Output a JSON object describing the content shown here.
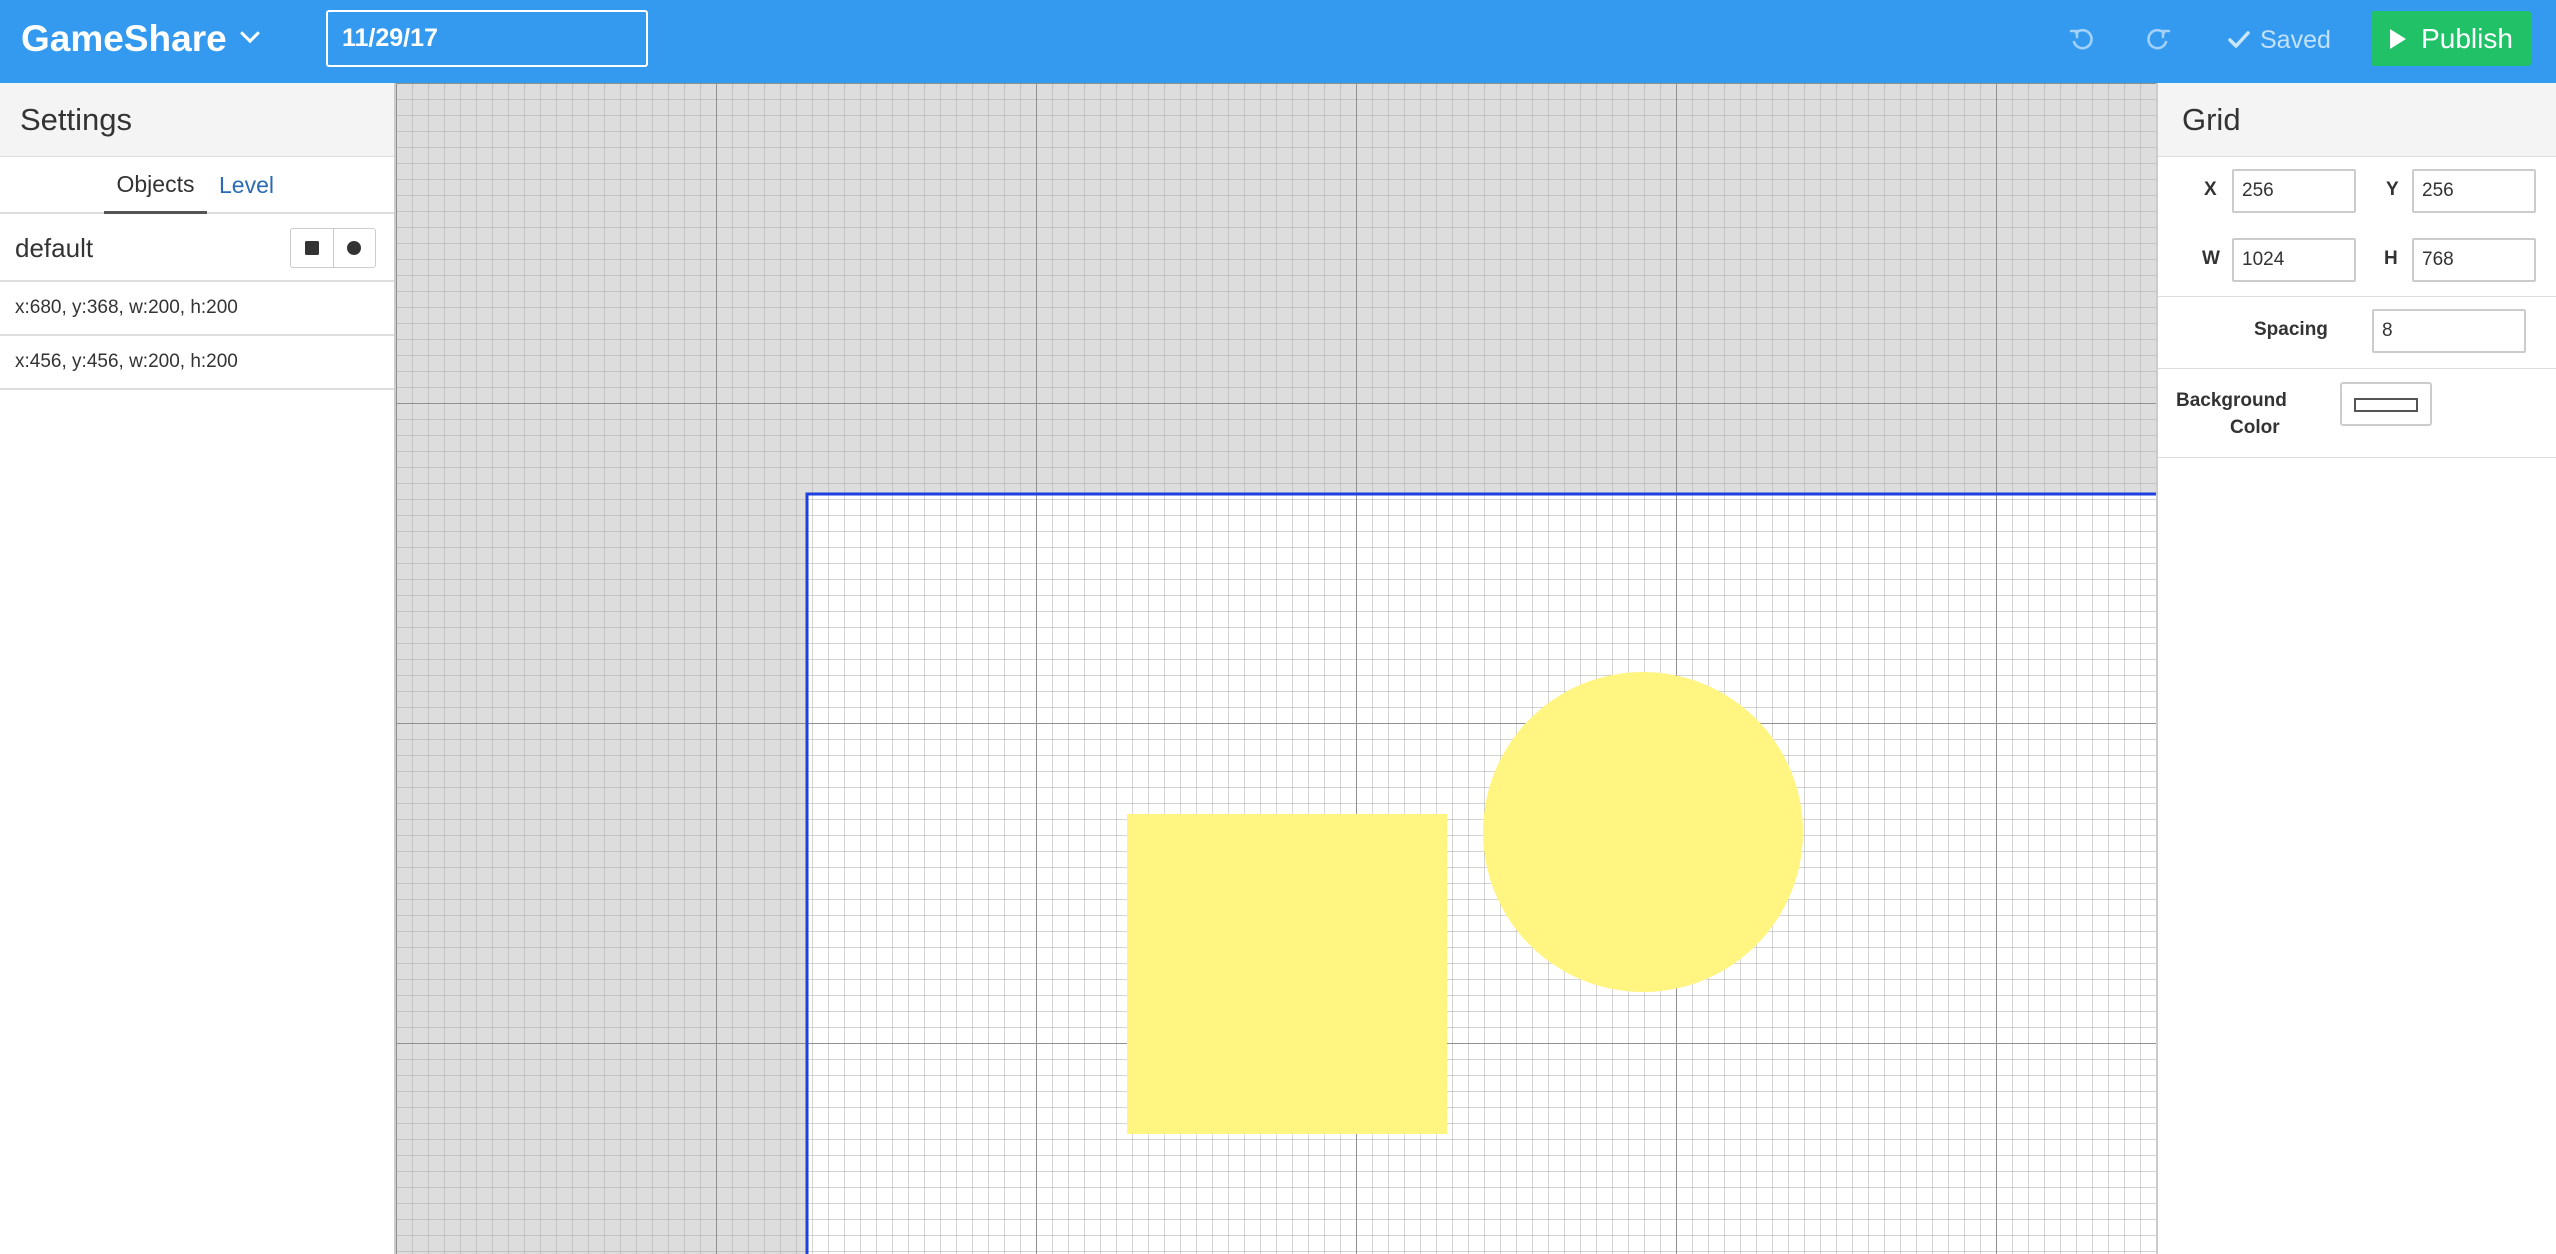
{
  "app": {
    "brand": "GameShare",
    "title_value": "11/29/17",
    "saved_label": "Saved",
    "publish_label": "Publish",
    "colors": {
      "topbar": "#339af0",
      "publish": "#20c167",
      "level_bounds": "#1f3fe0",
      "object_fill": "#fff580"
    }
  },
  "left_panel": {
    "header": "Settings",
    "tabs": [
      {
        "label": "Objects",
        "active": true
      },
      {
        "label": "Level",
        "active": false
      }
    ],
    "layer": {
      "name": "default",
      "add_square_icon": "square-icon",
      "add_circle_icon": "circle-icon"
    },
    "objects": [
      {
        "label": "x:680, y:368, w:200, h:200",
        "shape": "square"
      },
      {
        "label": "x:456, y:456, w:200, h:200",
        "shape": "circle"
      }
    ]
  },
  "right_panel": {
    "header": "Grid",
    "x_label": "X",
    "x_value": "256",
    "y_label": "Y",
    "y_value": "256",
    "w_label": "W",
    "w_value": "1024",
    "h_label": "H",
    "h_value": "768",
    "spacing_label": "Spacing",
    "spacing_value": "8",
    "background_label_line1": "Background",
    "background_label_line2": "Color",
    "background_color": "#ffffff"
  }
}
